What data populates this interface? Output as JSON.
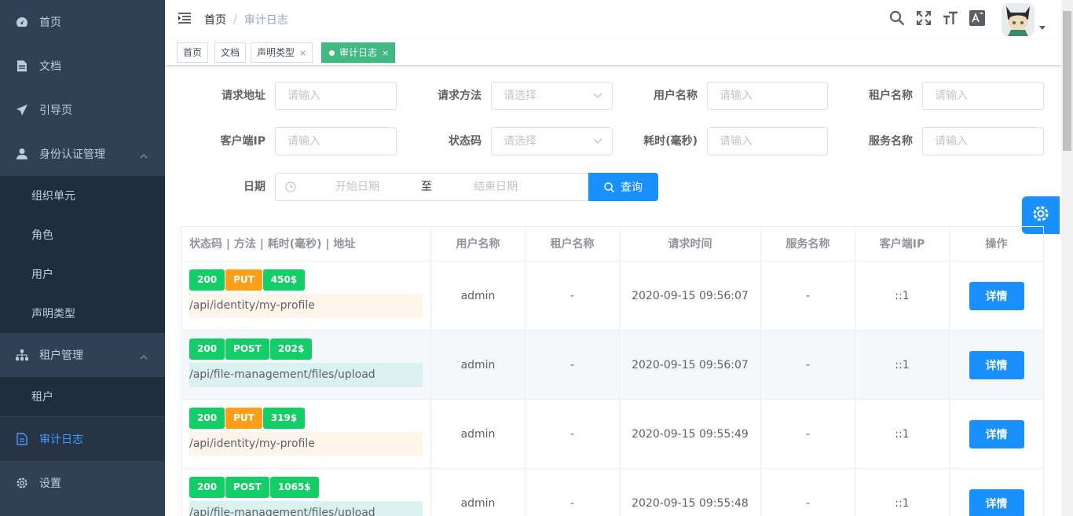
{
  "sidebar": {
    "items": [
      {
        "label": "首页",
        "icon": "dashboard-icon"
      },
      {
        "label": "文档",
        "icon": "document-icon"
      },
      {
        "label": "引导页",
        "icon": "guide-icon"
      },
      {
        "label": "身份认证管理",
        "icon": "user-icon"
      },
      {
        "label": "租户管理",
        "icon": "tree-icon"
      },
      {
        "label": "审计日志",
        "icon": "log-icon"
      },
      {
        "label": "设置",
        "icon": "gear-icon"
      }
    ],
    "identity_sub": [
      "组织单元",
      "角色",
      "用户",
      "声明类型"
    ],
    "tenant_sub": [
      "租户"
    ]
  },
  "breadcrumb": {
    "home": "首页",
    "separator": "/",
    "current": "审计日志"
  },
  "tags": {
    "home": "首页",
    "docs": "文档",
    "claims": "声明类型",
    "audit": "审计日志",
    "close": "×"
  },
  "form": {
    "url_label": "请求地址",
    "url_ph": "请输入",
    "method_label": "请求方法",
    "method_ph": "请选择",
    "user_label": "用户名称",
    "user_ph": "请输入",
    "tenant_label": "租户名称",
    "tenant_ph": "请输入",
    "ip_label": "客户端IP",
    "ip_ph": "请输入",
    "status_label": "状态码",
    "status_ph": "请选择",
    "duration_label": "耗时(毫秒)",
    "duration_ph": "请输入",
    "service_label": "服务名称",
    "service_ph": "请输入",
    "date_label": "日期",
    "start_ph": "开始日期",
    "to": "至",
    "end_ph": "结束日期",
    "query_label": "查询"
  },
  "table": {
    "headers": [
      "状态码 | 方法 | 耗时(毫秒) | 地址",
      "用户名称",
      "租户名称",
      "请求时间",
      "服务名称",
      "客户端IP",
      "操作"
    ],
    "rows": [
      {
        "status": "200",
        "method": "PUT",
        "duration": "450$",
        "path": "/api/identity/my-profile",
        "user": "admin",
        "tenant": "-",
        "time": "2020-09-15 09:56:07",
        "service": "-",
        "ip": "::1",
        "action": "详情"
      },
      {
        "status": "200",
        "method": "POST",
        "duration": "202$",
        "path": "/api/file-management/files/upload",
        "user": "admin",
        "tenant": "-",
        "time": "2020-09-15 09:56:07",
        "service": "-",
        "ip": "::1",
        "action": "详情"
      },
      {
        "status": "200",
        "method": "PUT",
        "duration": "319$",
        "path": "/api/identity/my-profile",
        "user": "admin",
        "tenant": "-",
        "time": "2020-09-15 09:55:49",
        "service": "-",
        "ip": "::1",
        "action": "详情"
      },
      {
        "status": "200",
        "method": "POST",
        "duration": "1065$",
        "path": "/api/file-management/files/upload",
        "user": "admin",
        "tenant": "-",
        "time": "2020-09-15 09:55:48",
        "service": "-",
        "ip": "::1",
        "action": "详情"
      }
    ]
  },
  "colors": {
    "primary": "#1890ff",
    "sidebar": "#304156",
    "success": "#13ce66",
    "warning": "#ff9e18",
    "tag_active": "#42b983"
  }
}
